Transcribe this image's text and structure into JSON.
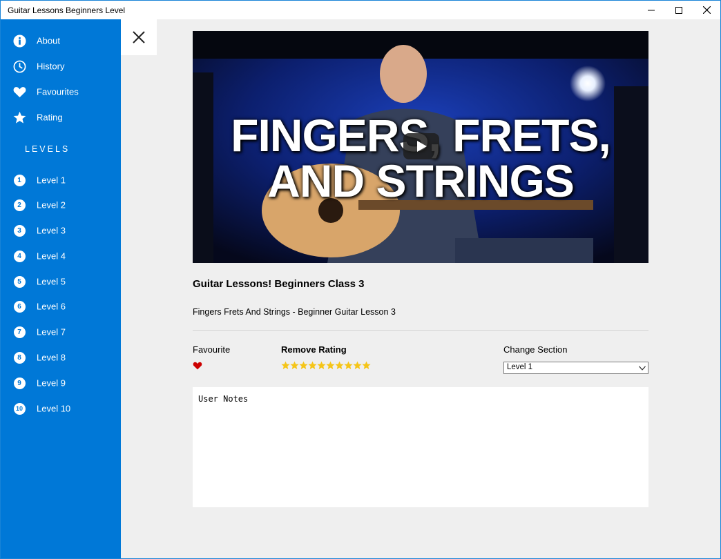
{
  "window": {
    "title": "Guitar Lessons Beginners Level"
  },
  "sidebar": {
    "items": [
      {
        "label": "About",
        "icon": "info-icon"
      },
      {
        "label": "History",
        "icon": "clock-icon"
      },
      {
        "label": "Favourites",
        "icon": "heart-icon"
      },
      {
        "label": "Rating",
        "icon": "star-icon"
      }
    ],
    "levels_heading": "LEVELS",
    "levels": [
      {
        "number": "1",
        "label": "Level 1"
      },
      {
        "number": "2",
        "label": "Level 2"
      },
      {
        "number": "3",
        "label": "Level 3"
      },
      {
        "number": "4",
        "label": "Level 4"
      },
      {
        "number": "5",
        "label": "Level 5"
      },
      {
        "number": "6",
        "label": "Level 6"
      },
      {
        "number": "7",
        "label": "Level 7"
      },
      {
        "number": "8",
        "label": "Level 8"
      },
      {
        "number": "9",
        "label": "Level 9"
      },
      {
        "number": "10",
        "label": "Level 10"
      }
    ]
  },
  "video": {
    "thumbnail_text_line1": "FINGERS, FRETS,",
    "thumbnail_text_line2": "AND STRINGS"
  },
  "lesson": {
    "title": "Guitar Lessons! Beginners Class 3",
    "subtitle": "Fingers Frets And Strings - Beginner Guitar Lesson 3"
  },
  "controls": {
    "favourite_label": "Favourite",
    "rating_label": "Remove Rating",
    "rating_stars": 10,
    "section_label": "Change Section",
    "section_selected": "Level 1"
  },
  "notes": {
    "placeholder": "User Notes"
  },
  "colors": {
    "accent": "#0078d7",
    "heart": "#e81123",
    "star": "#f5c518"
  }
}
